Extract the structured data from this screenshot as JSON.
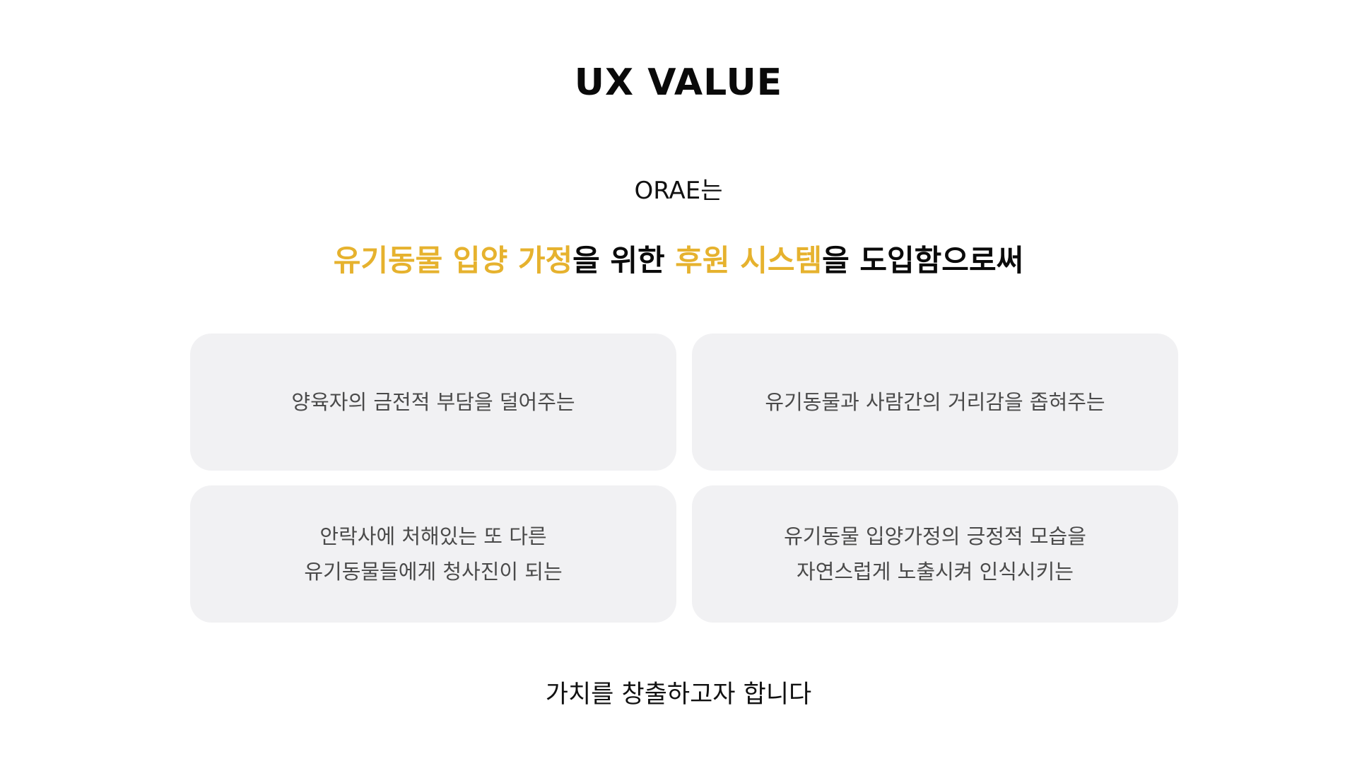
{
  "section": {
    "title": "UX VALUE",
    "intro": "ORAE는",
    "headline": {
      "parts": [
        {
          "text": "유기동물 입양 가정",
          "highlight": true
        },
        {
          "text": "을 위한 ",
          "highlight": false
        },
        {
          "text": "후원 시스템",
          "highlight": true
        },
        {
          "text": "을 도입함으로써",
          "highlight": false
        }
      ],
      "highlight_color": "#e6b22e"
    },
    "cards": [
      {
        "lines": [
          "양육자의 금전적 부담을 덜어주는"
        ]
      },
      {
        "lines": [
          "유기동물과 사람간의 거리감을 좁혀주는"
        ]
      },
      {
        "lines": [
          "안락사에 처해있는 또 다른",
          "유기동물들에게 청사진이 되는"
        ]
      },
      {
        "lines": [
          "유기동물 입양가정의 긍정적 모습을",
          "자연스럽게 노출시켜 인식시키는"
        ]
      }
    ],
    "closing": "가치를 창출하고자 합니다"
  },
  "colors": {
    "background": "#ffffff",
    "card_background": "#f1f1f3",
    "text": "#111111",
    "card_text": "#4a4a4a",
    "accent": "#e6b22e"
  }
}
